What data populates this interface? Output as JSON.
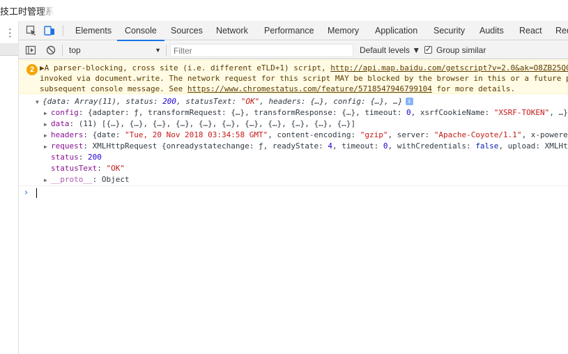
{
  "window": {
    "title": "技工时管理系"
  },
  "tabs": [
    "Elements",
    "Console",
    "Sources",
    "Network",
    "Performance",
    "Memory",
    "Application",
    "Security",
    "Audits",
    "React",
    "Red"
  ],
  "active_tab": "Console",
  "toolbar": {
    "context": "top",
    "filter_placeholder": "Filter",
    "levels_label": "Default levels ▼",
    "group_similar_label": "Group similar",
    "group_similar_checked": true
  },
  "warning": {
    "count": "2",
    "line1_pre": "▶A parser-blocking, cross site (i.e. different eTLD+1) script, ",
    "line1_link": "http://api.map.baidu.com/getscript?v=2.0&ak=O8ZB25Q0",
    "line2": "invoked via document.write. The network request for this script MAY be blocked by the browser in this or a future p",
    "line3_pre": "subsequent console message. See ",
    "line3_link": "https://www.chromestatus.com/feature/5718547946799104",
    "line3_post": " for more details."
  },
  "log": {
    "summary_open": "{data: Array(11), status: ",
    "summary_status": "200",
    "summary_mid": ", statusText: ",
    "summary_text": "\"OK\"",
    "summary_end": ", headers: {…}, config: {…}, …}",
    "info_glyph": "i",
    "config_key": "config",
    "config_val_pre": ": {adapter: ƒ, transformRequest: {…}, transformResponse: {…}, timeout: ",
    "config_timeout": "0",
    "config_val_mid": ", xsrfCookieName: ",
    "config_xsrf": "\"XSRF-TOKEN\"",
    "config_val_end": ", …}",
    "data_key": "data",
    "data_val": ": (11) [{…}, {…}, {…}, {…}, {…}, {…}, {…}, {…}, {…}, {…}, {…}]",
    "headers_key": "headers",
    "headers_val_pre": ": {date: ",
    "headers_date": "\"Tue, 20 Nov 2018 03:34:58 GMT\"",
    "headers_val_mid": ", content-encoding: ",
    "headers_enc": "\"gzip\"",
    "headers_val_mid2": ", server: ",
    "headers_server": "\"Apache-Coyote/1.1\"",
    "headers_val_end": ", x-powered",
    "request_key": "request",
    "request_val_pre": ": XMLHttpRequest {onreadystatechange: ƒ, readyState: ",
    "request_ready": "4",
    "request_val_mid": ", timeout: ",
    "request_timeout": "0",
    "request_val_mid2": ", withCredentials: ",
    "request_cred": "false",
    "request_val_end": ", upload: XMLHtt",
    "status_key": "status",
    "status_val": "200",
    "statustext_key": "statusText",
    "statustext_val": "\"OK\"",
    "proto_key": "__proto__",
    "proto_val": ": Object"
  },
  "prompt": {
    "chevron": "›"
  },
  "colors": {
    "accent": "#1a73e8",
    "warning_bg": "#fffbe5",
    "warning_badge": "#f2a600",
    "key": "#881391",
    "string": "#c41a16",
    "number": "#1c00cf"
  }
}
